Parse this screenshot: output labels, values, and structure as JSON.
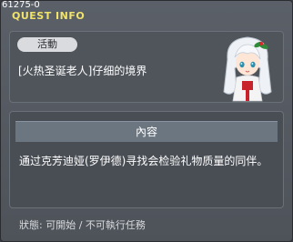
{
  "quest_id": "61275-0",
  "window": {
    "title": "QUEST INFO"
  },
  "activity": {
    "badge_label": "活動",
    "quest_name": "[火热圣诞老人]仔细的境界"
  },
  "content": {
    "header": "內容",
    "text": "通过克芳迪娅(罗伊德)寻找会检验礼物质量的同伴。"
  },
  "status": {
    "text": "狀態:  可開始  /  不可執行任務"
  },
  "colors": {
    "title": "#f0e36a",
    "badge_bg": "#d9dbde",
    "header_bg": "#6b7681",
    "panel_bg": "#50555c"
  },
  "icons": {
    "portrait": "npc-portrait-icon"
  }
}
